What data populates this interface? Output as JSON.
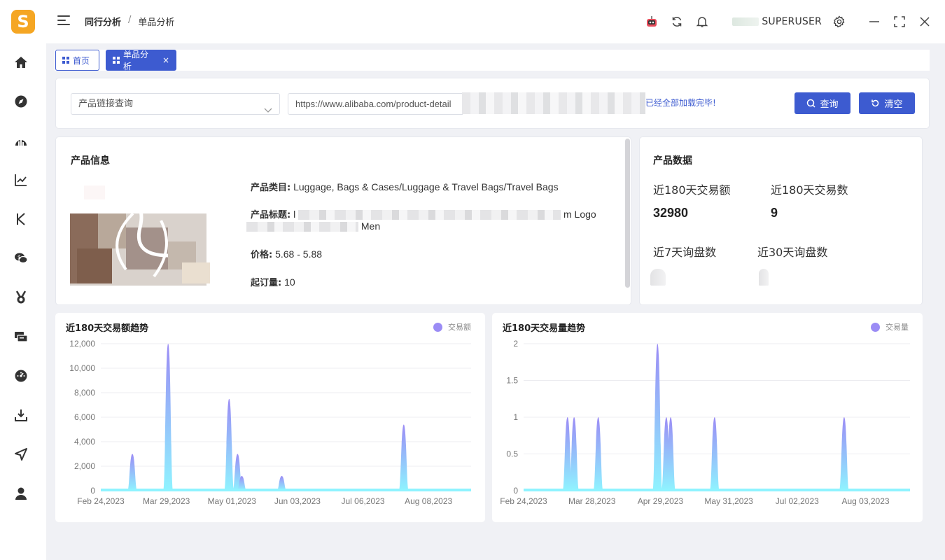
{
  "app": {
    "logo_letter": "S",
    "username": "SUPERUSER"
  },
  "breadcrumb": {
    "parent": "同行分析",
    "separator": "/",
    "current": "单品分析"
  },
  "tabs": [
    {
      "label": "首页"
    },
    {
      "label": "单品分析",
      "close": "×"
    }
  ],
  "search": {
    "select_value": "产品链接查询",
    "url_value": "https://www.alibaba.com/product-detail",
    "loaded_message": "已经全部加载完毕!",
    "query_button": "查询",
    "clear_button": "清空"
  },
  "product_info": {
    "title": "产品信息",
    "category_label": "产品类目:",
    "category_value": "Luggage, Bags & Cases/Luggage & Travel Bags/Travel Bags",
    "title_label": "产品标题:",
    "title_value_start": "l",
    "title_value_end1": "m Logo",
    "title_value_end2": "Men",
    "price_label": "价格:",
    "price_value": "5.68 - 5.88",
    "moq_label": "起订量:",
    "moq_value": "10"
  },
  "product_data": {
    "title": "产品数据",
    "gmv_180_label": "近180天交易额",
    "gmv_180_value": "32980",
    "orders_180_label": "近180天交易数",
    "orders_180_value": "9",
    "inquiries_7_label": "近7天询盘数",
    "inquiries_30_label": "近30天询盘数"
  },
  "colors": {
    "accent": "#3d5bd0",
    "logo": "#f5a623",
    "series_top": "#9b8cf5",
    "series_bottom": "#8ff3ff"
  },
  "icons": {
    "sidebar": [
      "home-icon",
      "compass-icon",
      "pie-signal-icon",
      "line-chart-icon",
      "letter-k-icon",
      "chat-icon",
      "medal-icon",
      "cards-icon",
      "dashboard-icon",
      "download-icon",
      "send-icon",
      "user-icon"
    ],
    "topbar": [
      "robot-icon",
      "refresh-icon",
      "bell-icon",
      "gear-icon",
      "minimize-icon",
      "maximize-icon",
      "close-icon"
    ]
  },
  "chart_data": [
    {
      "type": "area",
      "title": "近180天交易额趋势",
      "series": [
        {
          "name": "交易额",
          "points": [
            [
              "2023-03-11",
              3000
            ],
            [
              "2023-03-28",
              12000
            ],
            [
              "2023-04-26",
              7500
            ],
            [
              "2023-04-30",
              3000
            ],
            [
              "2023-05-02",
              1200
            ],
            [
              "2023-05-21",
              1200
            ],
            [
              "2023-07-18",
              5400
            ]
          ]
        }
      ],
      "x_ticks": [
        "Feb 24,2023",
        "Mar 29,2023",
        "May 01,2023",
        "Jun 03,2023",
        "Jul 06,2023",
        "Aug 08,2023"
      ],
      "y_ticks": [
        "0",
        "2,000",
        "4,000",
        "6,000",
        "8,000",
        "10,000",
        "12,000"
      ],
      "xlim": [
        "2023-02-24",
        "2023-08-19"
      ],
      "ylim": [
        0,
        12000
      ],
      "legend": "top-right",
      "grid": true
    },
    {
      "type": "area",
      "title": "近180天交易量趋势",
      "series": [
        {
          "name": "交易量",
          "points": [
            [
              "2023-03-16",
              1
            ],
            [
              "2023-03-19",
              1
            ],
            [
              "2023-03-30",
              1
            ],
            [
              "2023-04-26",
              2
            ],
            [
              "2023-04-30",
              1
            ],
            [
              "2023-05-02",
              1
            ],
            [
              "2023-05-22",
              1
            ],
            [
              "2023-07-20",
              1
            ]
          ]
        }
      ],
      "x_ticks": [
        "Feb 24,2023",
        "Mar 28,2023",
        "Apr 29,2023",
        "May 31,2023",
        "Jul 02,2023",
        "Aug 03,2023"
      ],
      "y_ticks": [
        "0",
        "0.5",
        "1",
        "1.5",
        "2"
      ],
      "xlim": [
        "2023-02-24",
        "2023-08-19"
      ],
      "ylim": [
        0,
        2
      ],
      "legend": "top-right",
      "grid": true
    }
  ]
}
